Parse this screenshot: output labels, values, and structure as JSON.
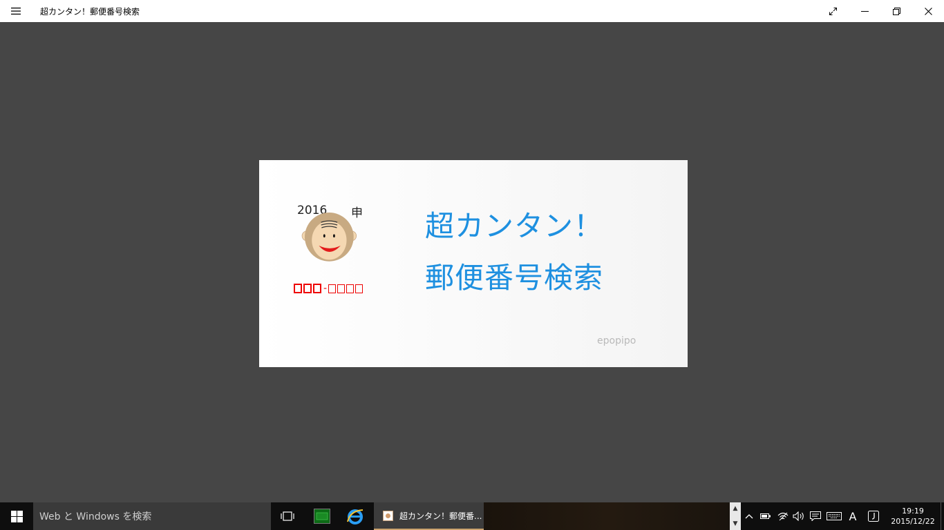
{
  "window": {
    "title": "超カンタン！郵便番号検索",
    "icons": {
      "menu": "hamburger-menu-icon",
      "fullscreen": "expand-icon",
      "minimize": "minimize-icon",
      "restore": "restore-icon",
      "close": "close-icon"
    }
  },
  "splash": {
    "year": "2016",
    "zodiac": "申",
    "postal_dash": "-",
    "title_line1": "超カンタン！",
    "title_line2": "郵便番号検索",
    "brand": "epopipo",
    "colors": {
      "title": "#1e90e0",
      "postal": "#e00000",
      "background": "#464646"
    }
  },
  "taskbar": {
    "search_placeholder": "Web と Windows を検索",
    "active_app_label": "超カンタン！郵便番...",
    "ime_label": "A",
    "time": "19:19",
    "date": "2015/12/22",
    "accent_color": "#cda46e"
  }
}
